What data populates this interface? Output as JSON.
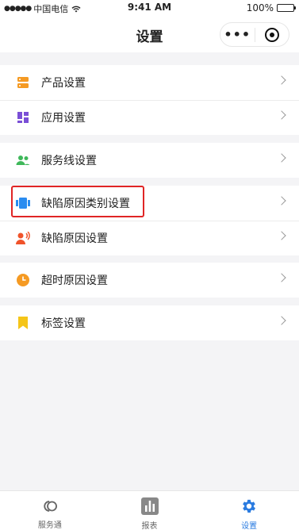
{
  "status_bar": {
    "signal_dots": "●●●●●",
    "carrier": "中国电信",
    "time": "9:41 AM",
    "battery": "100%"
  },
  "nav": {
    "title": "设置",
    "more": "•••"
  },
  "groups": [
    {
      "items": [
        {
          "label": "产品设置",
          "icon": "product-icon",
          "color": "#f59a23"
        },
        {
          "label": "应用设置",
          "icon": "app-icon",
          "color": "#7a4fd6"
        }
      ]
    },
    {
      "items": [
        {
          "label": "服务线设置",
          "icon": "team-icon",
          "color": "#3fb85a"
        }
      ]
    },
    {
      "items": [
        {
          "label": "缺陷原因类别设置",
          "icon": "category-icon",
          "color": "#2a8cf0"
        },
        {
          "label": "缺陷原因设置",
          "icon": "reason-icon",
          "color": "#f0532a"
        }
      ]
    },
    {
      "items": [
        {
          "label": "超时原因设置",
          "icon": "clock-icon",
          "color": "#f59a23"
        }
      ]
    },
    {
      "items": [
        {
          "label": "标签设置",
          "icon": "bookmark-icon",
          "color": "#f5c518"
        }
      ]
    }
  ],
  "tabs": [
    {
      "label": "服务通",
      "icon": "service-icon"
    },
    {
      "label": "报表",
      "icon": "chart-icon"
    },
    {
      "label": "设置",
      "icon": "gear-icon",
      "active": true
    }
  ],
  "colors": {
    "accent": "#2a7be0",
    "highlight": "#e02525"
  }
}
